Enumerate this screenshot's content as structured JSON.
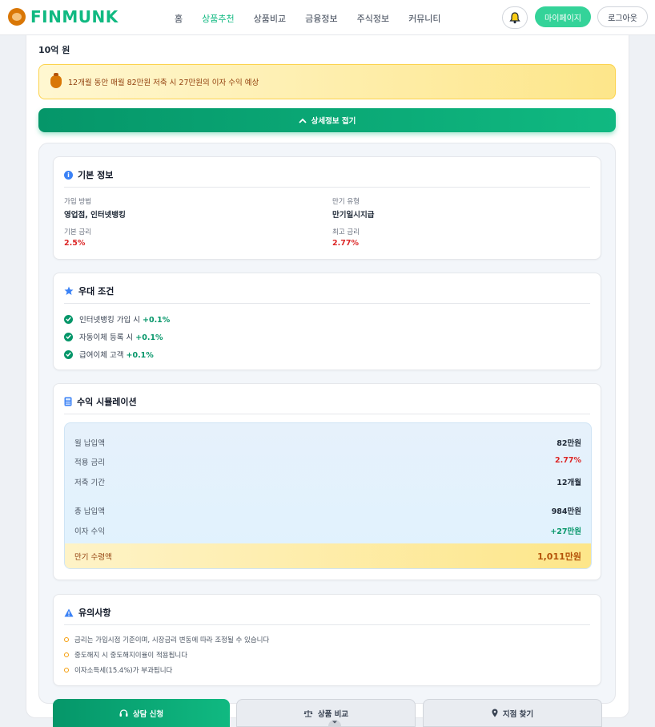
{
  "header": {
    "logo_text": "FINMUNK",
    "nav": [
      {
        "label": "홈",
        "active": false
      },
      {
        "label": "상품추천",
        "active": true
      },
      {
        "label": "상품비교",
        "active": false
      },
      {
        "label": "금융정보",
        "active": false
      },
      {
        "label": "주식정보",
        "active": false
      },
      {
        "label": "커뮤니티",
        "active": false
      }
    ],
    "mypage_label": "마이페이지",
    "logout_label": "로그아웃"
  },
  "summary": {
    "amount": "10억 원",
    "notice": "12개월 동안 매월 82만원 저축 시 27만원의 이자 수익 예상",
    "collapse_label": "상세정보 접기"
  },
  "basic_info": {
    "title": "기본 정보",
    "join_method_label": "가입 방법",
    "join_method": "영업점, 인터넷뱅킹",
    "maturity_type_label": "만기 유형",
    "maturity_type": "만기일시지급",
    "base_rate_label": "기본 금리",
    "base_rate": "2.5%",
    "max_rate_label": "최고 금리",
    "max_rate": "2.77%"
  },
  "benefits": {
    "title": "우대 조건",
    "items": [
      {
        "text": "인터넷뱅킹 가입 시",
        "bonus": "+0.1%"
      },
      {
        "text": "자동이체 등록 시",
        "bonus": "+0.1%"
      },
      {
        "text": "급여이체 고객",
        "bonus": "+0.1%"
      }
    ]
  },
  "simulation": {
    "title": "수익 시뮬레이션",
    "rows": [
      {
        "label": "월 납입액",
        "value": "82만원",
        "tone": "default"
      },
      {
        "label": "적용 금리",
        "value": "2.77%",
        "tone": "red"
      },
      {
        "label": "저축 기간",
        "value": "12개월",
        "tone": "default"
      },
      {
        "label": "총 납입액",
        "value": "984만원",
        "tone": "default"
      },
      {
        "label": "이자 수익",
        "value": "+27만원",
        "tone": "green"
      }
    ],
    "total_label": "만기 수령액",
    "total_value": "1,011만원"
  },
  "cautions": {
    "title": "유의사항",
    "items": [
      "금리는 가입시점 기준이며, 시장금리 변동에 따라 조정될 수 있습니다",
      "중도해지 시 중도해지이율이 적용됩니다",
      "이자소득세(15.4%)가 부과됩니다"
    ]
  },
  "actions": {
    "consult_label": "상담 신청",
    "compare_label": "상품 비교",
    "branch_label": "지점 찾기"
  },
  "colors": {
    "brand_green": "#10b981",
    "rate_red": "#dc2626",
    "notice_amber": "#92400e"
  }
}
